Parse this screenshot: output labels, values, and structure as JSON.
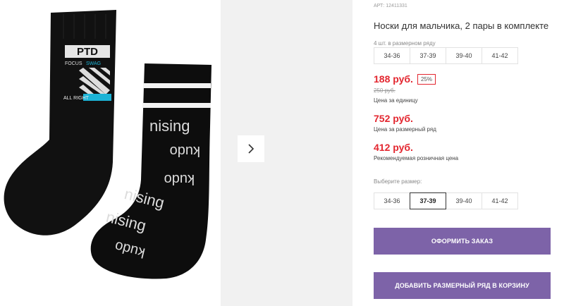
{
  "product": {
    "article": "АРТ: 12411331",
    "title": "Носки для мальчика, 2 пары в комплекте"
  },
  "row_sizes": {
    "hint": "4 шт. в размерном ряду",
    "sizes": [
      "34-36",
      "37-39",
      "39-40",
      "41-42"
    ]
  },
  "pricing": {
    "unit_price": "188 руб.",
    "discount": "25%",
    "old_price": "250 руб.",
    "unit_label": "Цена за единицу",
    "row_price": "752 руб.",
    "row_label": "Цена за размерный ряд",
    "retail_price": "412 руб.",
    "retail_label": "Рекомендуемая розничная цена"
  },
  "size_select": {
    "hint": "Выберите размер:",
    "sizes": [
      "34-36",
      "37-39",
      "39-40",
      "41-42"
    ],
    "selected": "37-39"
  },
  "actions": {
    "order": "ОФОРМИТЬ ЗАКАЗ",
    "add_row": "ДОБАВИТЬ РАЗМЕРНЫЙ РЯД В КОРЗИНУ"
  },
  "image": {
    "logo_ptd": "PTD",
    "logo_focus": "FOCUS",
    "logo_swag": "SWAG",
    "logo_all_right": "ALL RIGHT",
    "sock_text": "nising",
    "sock_text_alt": "kudo"
  },
  "colors": {
    "accent_button": "#7d63a8",
    "price_red": "#e3262f",
    "logo_cyan": "#1cb3d6"
  }
}
